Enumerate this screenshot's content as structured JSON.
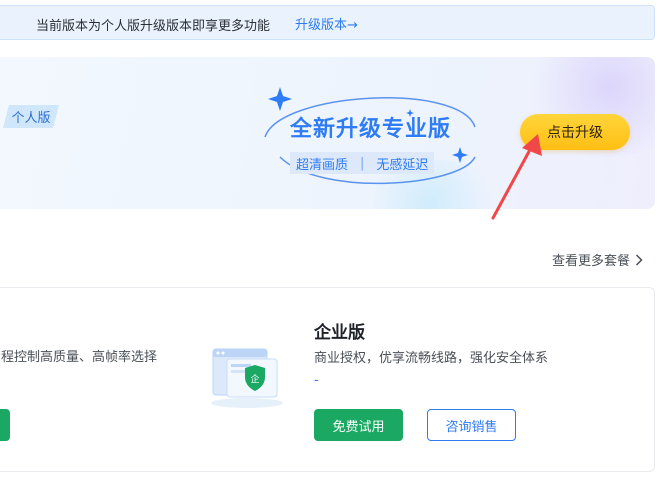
{
  "notice": {
    "text": "当前版本为个人版升级版本即享更多功能",
    "link": "升级版本→"
  },
  "banner": {
    "personal_tag": "个人版",
    "title": "全新升级专业版",
    "features": [
      "超清画质",
      "无感延迟"
    ],
    "separator": "|",
    "upgrade_button": "点击升级"
  },
  "more_packages": {
    "label": "查看更多套餐",
    "icon": "chevron-right-icon"
  },
  "packages": {
    "left_description": "程控制高质量、高帧率选择",
    "enterprise": {
      "title": "企业版",
      "description": "商业授权，优享流畅线路，强化安全体系",
      "extra": "-",
      "badge_char": "企",
      "free_trial_button": "免费试用",
      "consult_button": "咨询销售"
    }
  },
  "colors": {
    "accent_blue": "#2f7bf0",
    "green": "#1aa863",
    "yellow": "#ffc71f",
    "arrow_red": "#f04848"
  }
}
